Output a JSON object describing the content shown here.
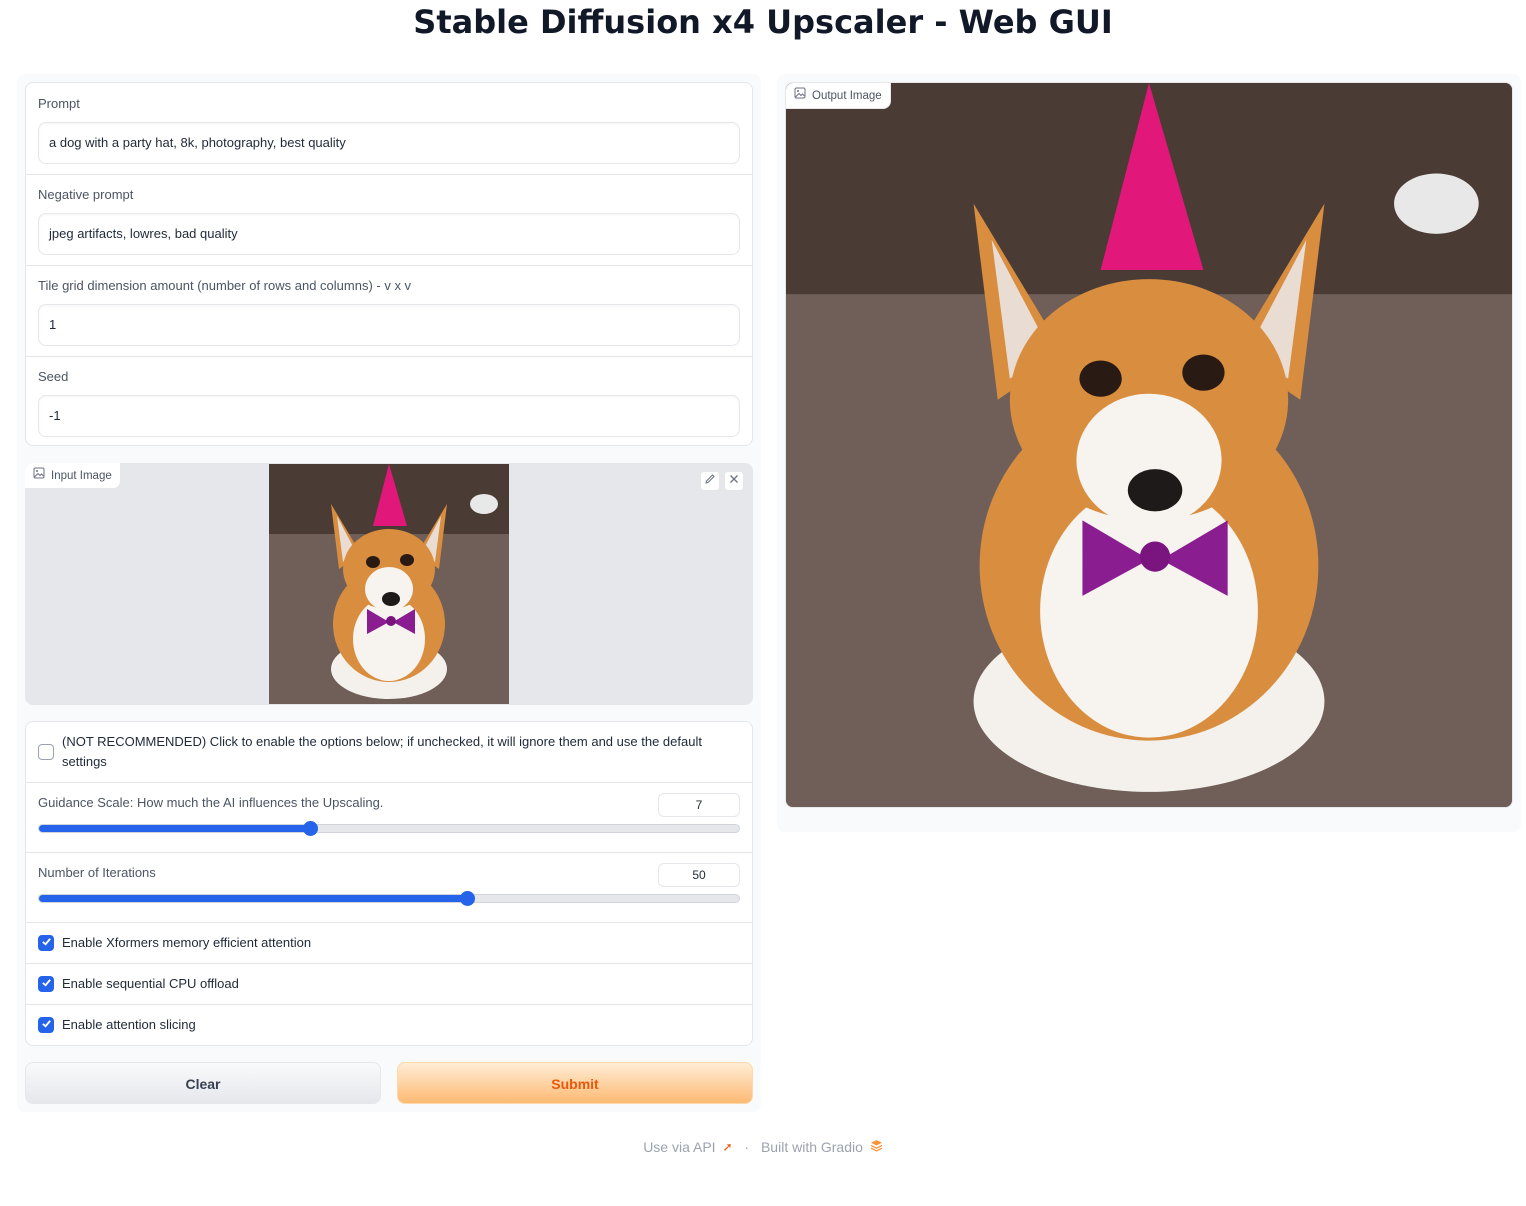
{
  "header": {
    "title": "Stable Diffusion x4 Upscaler - Web GUI"
  },
  "inputs": {
    "prompt": {
      "label": "Prompt",
      "value": "a dog with a party hat, 8k, photography, best quality"
    },
    "negative_prompt": {
      "label": "Negative prompt",
      "value": "jpeg artifacts, lowres, bad quality"
    },
    "tile_grid": {
      "label": "Tile grid dimension amount (number of rows and columns) - v x v",
      "value": "1"
    },
    "seed": {
      "label": "Seed",
      "value": "-1"
    }
  },
  "input_image": {
    "label": "Input Image",
    "icon": "image-icon",
    "edit_icon": "pencil-icon",
    "clear_icon": "close-icon"
  },
  "options": {
    "enable_checkbox": {
      "label": "(NOT RECOMMENDED) Click to enable the options below; if unchecked, it will ignore them and use the default settings",
      "checked": false
    },
    "guidance_scale": {
      "label": "Guidance Scale: How much the AI influences the Upscaling.",
      "value": "7",
      "fraction": 0.388
    },
    "iterations": {
      "label": "Number of Iterations",
      "value": "50",
      "fraction": 0.612
    },
    "xformers": {
      "label": "Enable Xformers memory efficient attention",
      "checked": true
    },
    "cpu_offload": {
      "label": "Enable sequential CPU offload",
      "checked": true
    },
    "attention_slicing": {
      "label": "Enable attention slicing",
      "checked": true
    }
  },
  "buttons": {
    "clear": "Clear",
    "submit": "Submit"
  },
  "output_image": {
    "label": "Output Image",
    "icon": "image-icon"
  },
  "footer": {
    "api_link": "Use via API",
    "separator": "·",
    "built_with": "Built with Gradio"
  },
  "colors": {
    "accent": "#2563eb",
    "submit_text": "#ea580c",
    "submit_bg": "#fdba74"
  }
}
